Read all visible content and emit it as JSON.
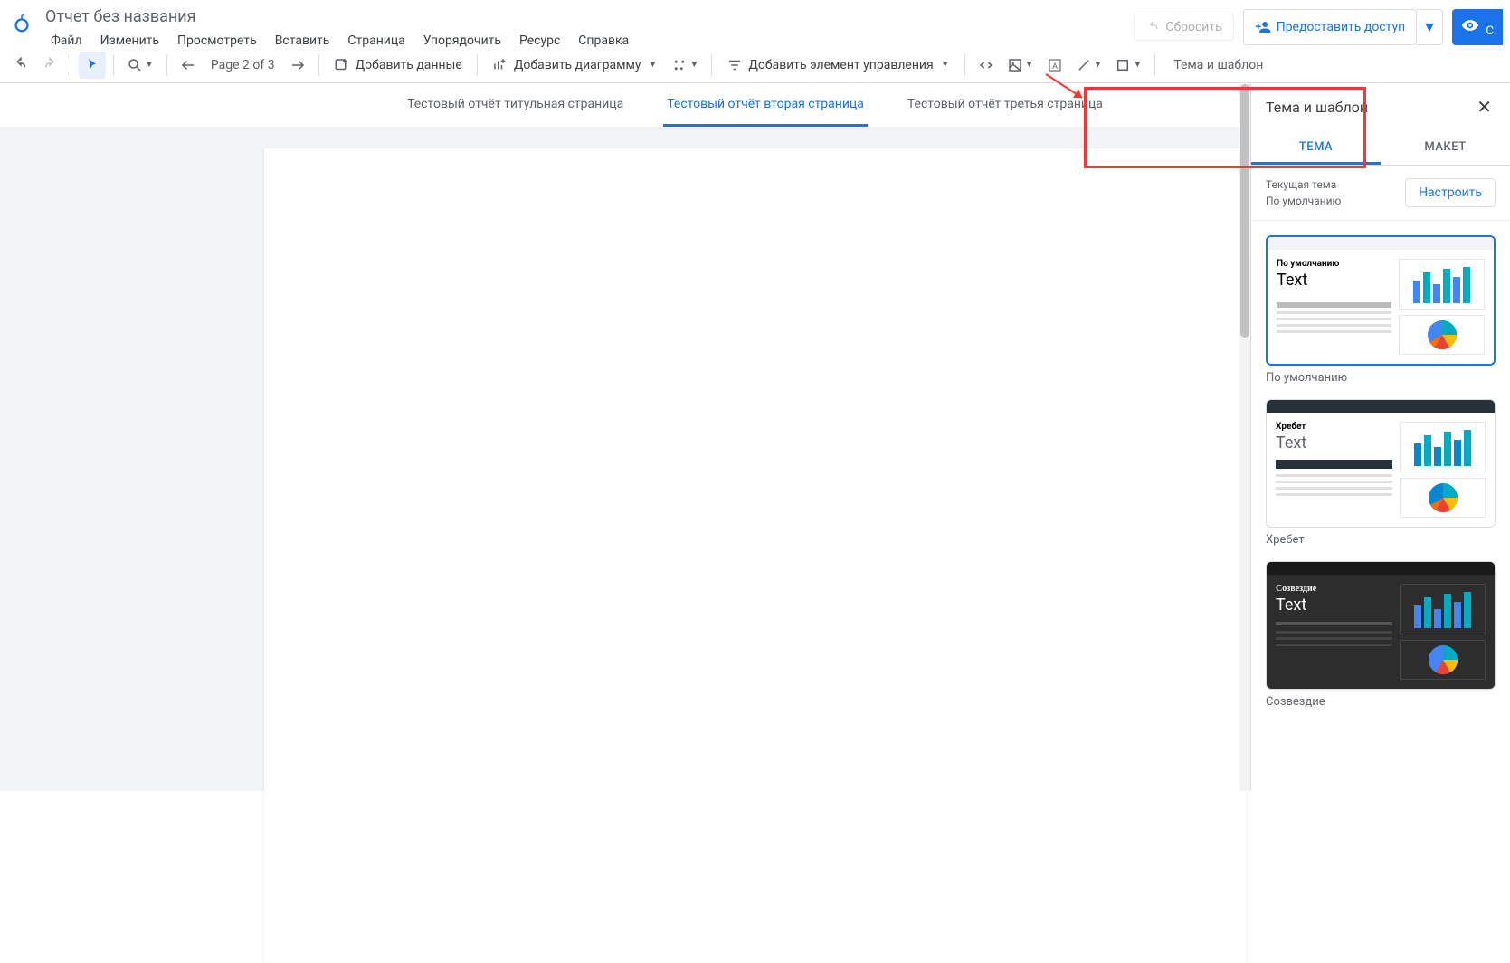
{
  "header": {
    "title": "Отчет без названия",
    "reset": "Сбросить",
    "share": "Предоставить доступ"
  },
  "menu": {
    "file": "Файл",
    "edit": "Изменить",
    "view": "Просмотреть",
    "insert": "Вставить",
    "page": "Страница",
    "arrange": "Упорядочить",
    "resource": "Ресурс",
    "help": "Справка"
  },
  "toolbar": {
    "page_indicator": "Page 2 of 3",
    "add_data": "Добавить данные",
    "add_chart": "Добавить диаграмму",
    "add_control": "Добавить элемент управления",
    "theme_layout": "Тема и шаблон"
  },
  "tabs": {
    "t1": "Тестовый отчёт титульная страница",
    "t2": "Тестовый отчёт вторая страница",
    "t3": "Тестовый отчёт третья страница"
  },
  "panel": {
    "title": "Тема и шаблон",
    "tab_theme": "ТЕМА",
    "tab_layout": "МАКЕТ",
    "current_label": "Текущая тема",
    "current_value": "По умолчанию",
    "configure": "Настроить",
    "themes": {
      "default": {
        "name": "По умолчанию",
        "title": "По умолчанию",
        "text": "Text"
      },
      "ridge": {
        "name": "Хребет",
        "title": "Хребет",
        "text": "Text"
      },
      "constellation": {
        "name": "Созвездие",
        "title": "Созвездие",
        "text": "Text"
      }
    }
  },
  "colors": {
    "primary": "#1a73e8",
    "annotation": "#ff3333"
  }
}
